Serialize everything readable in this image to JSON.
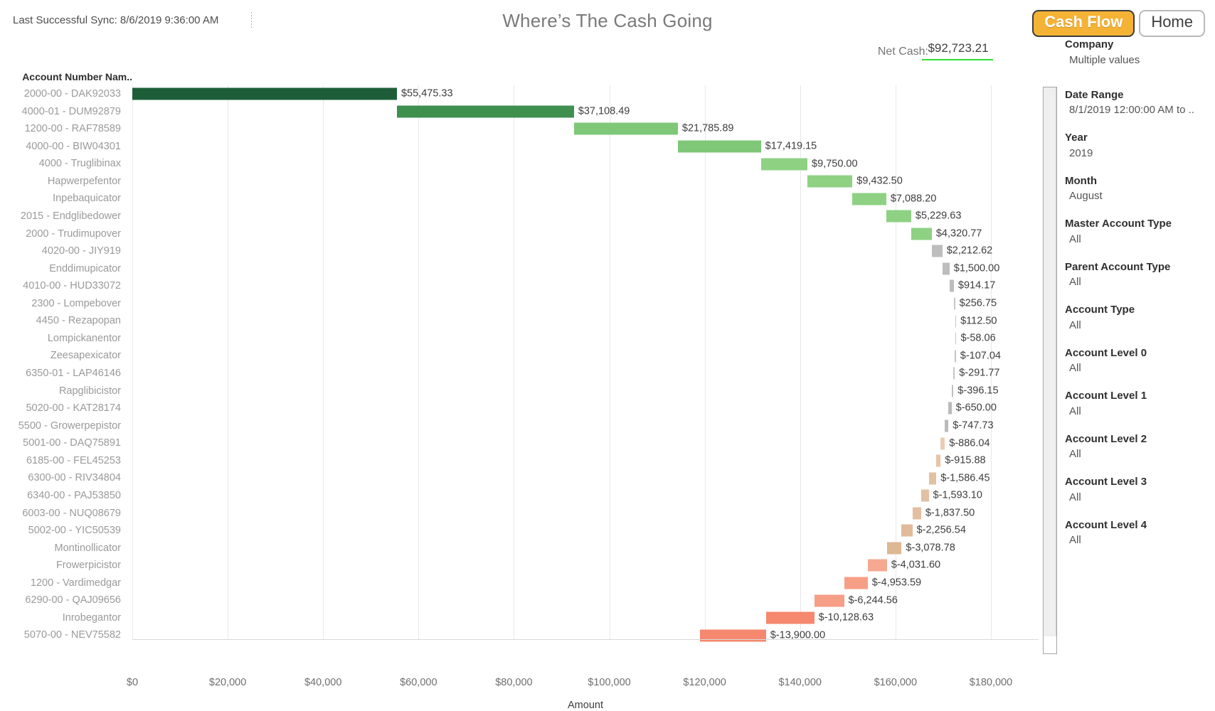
{
  "header": {
    "sync_text": "Last Successful Sync: 8/6/2019 9:36:00 AM",
    "title": "Where’s The Cash Going",
    "net_cash_label": "Net Cash:",
    "net_cash_value": "$92,723.21",
    "net_cash_accent": "#33dd33"
  },
  "nav": {
    "active_tab": "Cash Flow",
    "home_tab": "Home",
    "active_bg": "#f5b335"
  },
  "filters": {
    "company": {
      "title": "Company",
      "value": "Multiple values"
    },
    "items": [
      {
        "title": "Date Range",
        "value": "8/1/2019 12:00:00 AM to .."
      },
      {
        "title": "Year",
        "value": "2019"
      },
      {
        "title": "Month",
        "value": "August"
      },
      {
        "title": "Master Account Type",
        "value": "All"
      },
      {
        "title": "Parent Account Type",
        "value": "All"
      },
      {
        "title": "Account Type",
        "value": "All"
      },
      {
        "title": "Account Level 0",
        "value": "All"
      },
      {
        "title": "Account Level 1",
        "value": "All"
      },
      {
        "title": "Account Level 2",
        "value": "All"
      },
      {
        "title": "Account Level 3",
        "value": "All"
      },
      {
        "title": "Account Level 4",
        "value": "All"
      }
    ]
  },
  "chart_data": {
    "type": "bar",
    "subtype": "waterfall-horizontal",
    "title": "Where’s The Cash Going",
    "xlabel": "Amount",
    "ylabel": "Account Number Nam..",
    "xlim": [
      0,
      190000
    ],
    "xticks": [
      "$0",
      "$20,000",
      "$40,000",
      "$60,000",
      "$80,000",
      "$100,000",
      "$120,000",
      "$140,000",
      "$160,000",
      "$180,000"
    ],
    "xtick_values": [
      0,
      20000,
      40000,
      60000,
      80000,
      100000,
      120000,
      140000,
      160000,
      180000
    ],
    "grid": true,
    "legend": "none",
    "categories": [
      "2000-00 - DAK92033",
      "4000-01 - DUM92879",
      "1200-00 - RAF78589",
      "4000-00 - BIW04301",
      "4000 - Truglibinax",
      "Hapwerpefentor",
      "Inpebaquicator",
      "2015 - Endglibedower",
      "2000 - Trudimupover",
      "4020-00 - JIY919",
      "Enddimupicator",
      "4010-00 - HUD33072",
      "2300 - Lompebover",
      "4450 - Rezapopan",
      "Lompickanentor",
      "Zeesapexicator",
      "6350-01 - LAP46146",
      "Rapglibicistor",
      "5020-00 - KAT28174",
      "5500 - Growerpepistor",
      "5001-00 - DAQ75891",
      "6185-00 - FEL45253",
      "6300-00 - RIV34804",
      "6340-00 - PAJ53850",
      "6003-00 - NUQ08679",
      "5002-00 - YIC50539",
      "Montinollicator",
      "Frowerpicistor",
      "1200 - Vardimedgar",
      "6290-00 - QAJ09656",
      "Inrobegantor",
      "5070-00 - NEV75582"
    ],
    "labels": [
      "$55,475.33",
      "$37,108.49",
      "$21,785.89",
      "$17,419.15",
      "$9,750.00",
      "$9,432.50",
      "$7,088.20",
      "$5,229.63",
      "$4,320.77",
      "$2,212.62",
      "$1,500.00",
      "$914.17",
      "$256.75",
      "$112.50",
      "$-58.06",
      "$-107.04",
      "$-291.77",
      "$-396.15",
      "$-650.00",
      "$-747.73",
      "$-886.04",
      "$-915.88",
      "$-1,586.45",
      "$-1,593.10",
      "$-1,837.50",
      "$-2,256.54",
      "$-3,078.78",
      "$-4,031.60",
      "$-4,953.59",
      "$-6,244.56",
      "$-10,128.63",
      "$-13,900.00"
    ],
    "values": [
      55475.33,
      37108.49,
      21785.89,
      17419.15,
      9750.0,
      9432.5,
      7088.2,
      5229.63,
      4320.77,
      2212.62,
      1500.0,
      914.17,
      256.75,
      112.5,
      -58.06,
      -107.04,
      -291.77,
      -396.15,
      -650.0,
      -747.73,
      -886.04,
      -915.88,
      -1586.45,
      -1593.1,
      -1837.5,
      -2256.54,
      -3078.78,
      -4031.6,
      -4953.59,
      -6244.56,
      -10128.63,
      -13900.0
    ],
    "starts": [
      0,
      55475.33,
      92583.82,
      114369.71,
      131788.86,
      141538.86,
      150971.36,
      158059.56,
      163289.19,
      167609.96,
      169822.58,
      171322.58,
      172236.75,
      172493.5,
      172606.0,
      172547.94,
      172440.9,
      172149.13,
      171752.98,
      171102.98,
      170355.25,
      169469.21,
      168553.33,
      166966.88,
      165373.78,
      163536.28,
      161279.74,
      158200.96,
      154169.36,
      149215.77,
      142971.21,
      132842.58
    ],
    "colors": [
      "#1d5e38",
      "#3f8f4f",
      "#7fc878",
      "#7fc878",
      "#8ed183",
      "#8ed183",
      "#8ed183",
      "#8ed183",
      "#8ed183",
      "#bdbdbd",
      "#bdbdbd",
      "#bdbdbd",
      "#c6c6c6",
      "#c6c6c6",
      "#c6c6c6",
      "#c6c6c6",
      "#c6c6c6",
      "#bfbfbf",
      "#bababa",
      "#bababa",
      "#e9cdb4",
      "#e9c3a5",
      "#e2c0a2",
      "#e2c0a2",
      "#e3bfa0",
      "#e0bb9b",
      "#ddb893",
      "#f7a891",
      "#f79e86",
      "#f79e86",
      "#f5886e",
      "#f5886e"
    ]
  }
}
